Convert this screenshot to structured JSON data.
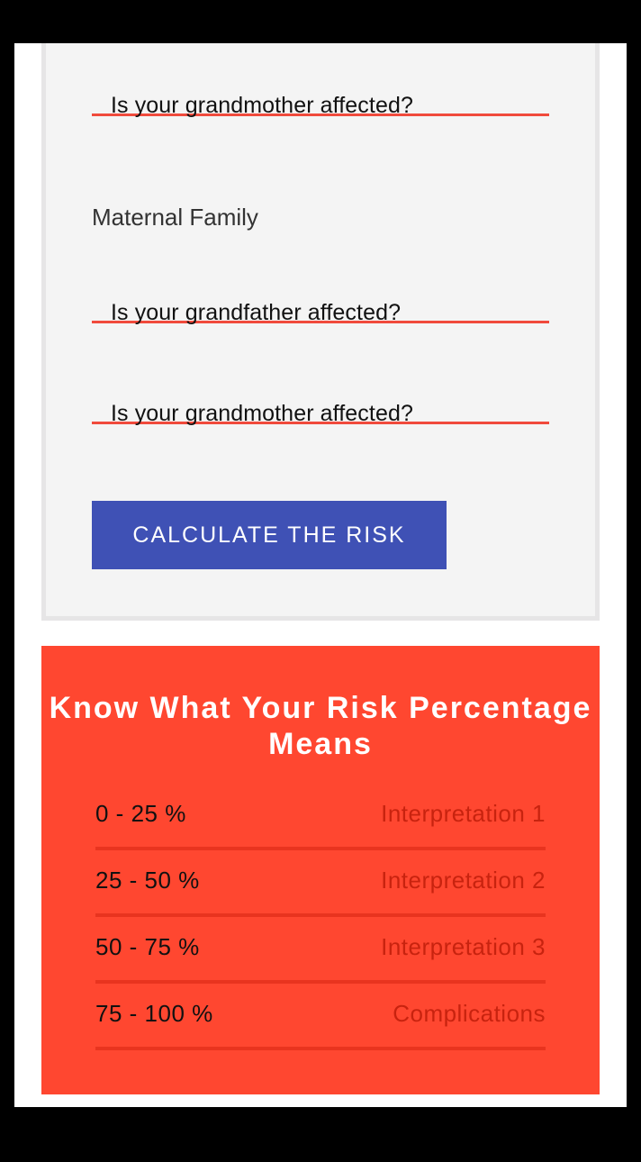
{
  "form": {
    "paternal_grandmother_question": "Is your grandmother affected?",
    "maternal_section_label": "Maternal Family",
    "maternal_grandfather_question": "Is your grandfather affected?",
    "maternal_grandmother_question": "Is your grandmother affected?",
    "calculate_button_label": "CALCULATE THE RISK"
  },
  "risk_info": {
    "title": "Know What Your Risk Percentage Means",
    "rows": [
      {
        "range": "0 - 25 %",
        "meaning": "Interpretation 1"
      },
      {
        "range": "25 - 50 %",
        "meaning": "Interpretation 2"
      },
      {
        "range": "50 - 75 %",
        "meaning": "Interpretation 3"
      },
      {
        "range": "75 - 100 %",
        "meaning": "Complications"
      }
    ]
  },
  "colors": {
    "accent_underline": "#f04a3c",
    "button": "#3f51b5",
    "risk_card": "#ff4730"
  }
}
